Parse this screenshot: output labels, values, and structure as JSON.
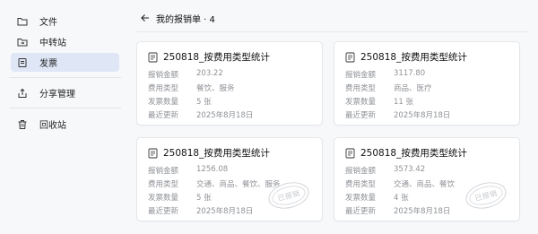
{
  "sidebar": {
    "items": [
      {
        "label": "文件",
        "icon": "folder-icon",
        "active": false
      },
      {
        "label": "中转站",
        "icon": "transfer-folder-icon",
        "active": false
      },
      {
        "label": "发票",
        "icon": "invoice-icon",
        "active": true
      },
      {
        "label": "分享管理",
        "icon": "share-icon",
        "active": false
      },
      {
        "label": "回收站",
        "icon": "trash-icon",
        "active": false
      }
    ]
  },
  "header": {
    "title": "我的报销单 · 4"
  },
  "labels": {
    "amount": "报销金额",
    "type": "费用类型",
    "count": "发票数量",
    "updated": "最近更新"
  },
  "cards": [
    {
      "title": "250818_按费用类型统计",
      "amount": "203.22",
      "type": "餐饮、服务",
      "count": "5 张",
      "updated": "2025年8月18日",
      "stamp": ""
    },
    {
      "title": "250818_按费用类型统计",
      "amount": "3117.80",
      "type": "商品、医疗",
      "count": "11 张",
      "updated": "2025年8月18日",
      "stamp": ""
    },
    {
      "title": "250818_按费用类型统计",
      "amount": "1256.08",
      "type": "交通、商品、餐饮、服务",
      "count": "5 张",
      "updated": "2025年8月18日",
      "stamp": "已报销"
    },
    {
      "title": "250818_按费用类型统计",
      "amount": "3573.42",
      "type": "交通、商品、餐饮",
      "count": "4 张",
      "updated": "2025年8月18日",
      "stamp": "已报销"
    }
  ],
  "colors": {
    "active_nav_bg": "#dfe7f7",
    "page_bg": "#f7f8fa",
    "card_bg": "#ffffff"
  }
}
